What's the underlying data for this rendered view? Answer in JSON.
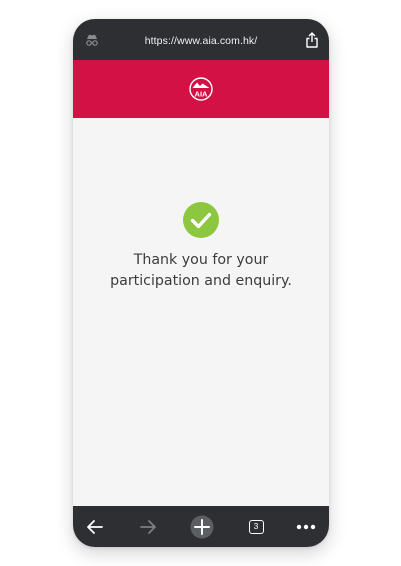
{
  "browser": {
    "url": "https://www.aia.com.hk/",
    "tab_count": "3"
  },
  "brand": {
    "color": "#d31145",
    "logo_text": "AIA"
  },
  "main": {
    "message_line1": "Thank you for your",
    "message_line2": "participation and enquiry.",
    "status_icon": "checkmark-circle-icon",
    "status_color": "#8dc63f"
  },
  "toolbar_icons": [
    "back-arrow-icon",
    "forward-arrow-icon",
    "new-tab-plus-icon",
    "tabs-count-icon",
    "more-dots-icon"
  ]
}
